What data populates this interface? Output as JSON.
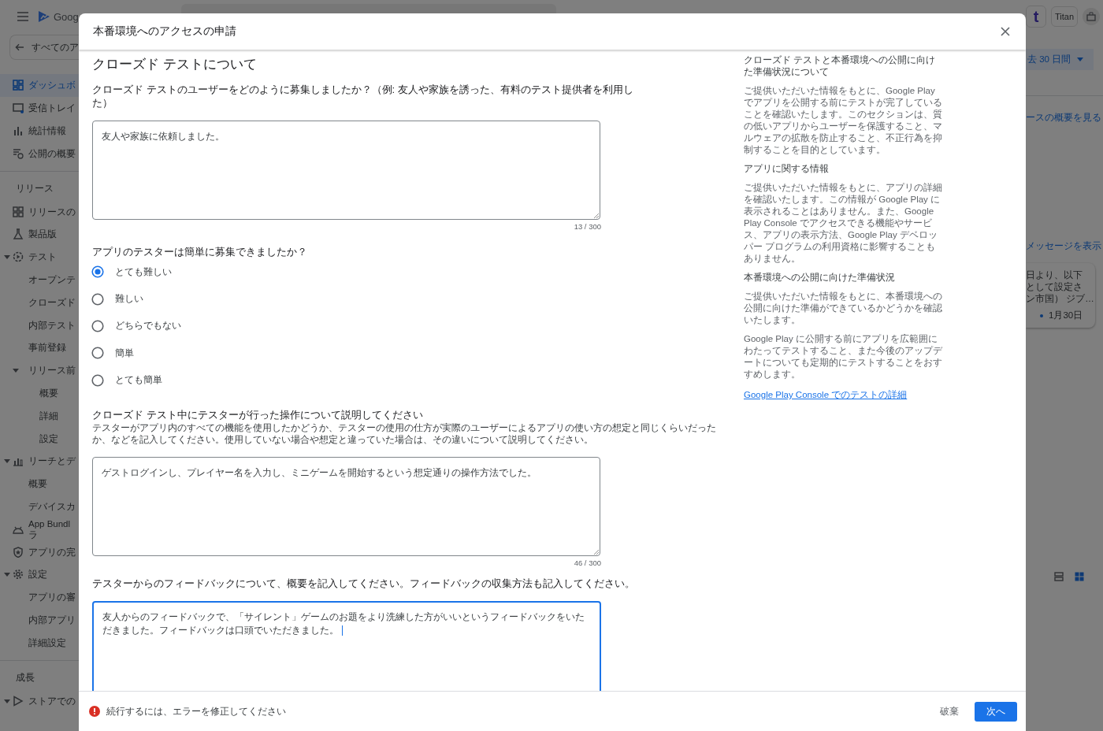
{
  "app_bar": {
    "logo_text": "Goog",
    "app_letter": "t",
    "account_name": "Titan"
  },
  "sidebar": {
    "back_link": "すべてのア",
    "sections": [
      {
        "items": [
          {
            "label": "ダッシュボ",
            "selected": true
          },
          {
            "label": "受信トレイ",
            "selected": false
          },
          {
            "label": "統計情報",
            "selected": false
          },
          {
            "label": "公開の概要",
            "selected": false
          }
        ]
      },
      {
        "heading": "リリース",
        "items": [
          {
            "label": "リリースの",
            "selected": false
          },
          {
            "label": "製品版",
            "selected": false
          },
          {
            "label": "テスト",
            "selected": false,
            "expanded": true,
            "children": [
              {
                "label": "オープンテ",
                "selected": false
              },
              {
                "label": "クローズド",
                "selected": false
              },
              {
                "label": "内部テスト",
                "selected": false
              },
              {
                "label": "事前登録",
                "selected": false
              },
              {
                "label": "リリース前",
                "selected": false,
                "expanded": true,
                "children": [
                  {
                    "label": "概要",
                    "selected": false
                  },
                  {
                    "label": "詳細",
                    "selected": false
                  },
                  {
                    "label": "設定",
                    "selected": false
                  }
                ]
              }
            ]
          },
          {
            "label": "リーチとデ",
            "selected": false,
            "expanded": true,
            "children": [
              {
                "label": "概要",
                "selected": false
              },
              {
                "label": "デバイスカ",
                "selected": false
              }
            ]
          },
          {
            "label": "App Bundl ラ",
            "selected": false
          },
          {
            "label": "アプリの完",
            "selected": false
          },
          {
            "label": "設定",
            "selected": false,
            "expanded": true,
            "children": [
              {
                "label": "アプリの審",
                "selected": false
              },
              {
                "label": "内部アプリ",
                "selected": false
              },
              {
                "label": "詳細設定",
                "selected": false
              }
            ]
          }
        ]
      },
      {
        "heading": "成長",
        "items": [
          {
            "label": "ストアでの",
            "selected": false,
            "expanded": true
          }
        ]
      }
    ]
  },
  "main_right": {
    "date_range": "去 30 日間",
    "overview_link": "ースの概要を見る",
    "messages_link": "メッセージを表示",
    "message_card": {
      "lines": [
        "日より、以下",
        "として設定さ",
        "ン市国） ジブ…"
      ],
      "date": "1月30日"
    },
    "view_toggle": [
      {
        "selected": false
      },
      {
        "selected": true
      }
    ]
  },
  "dialog": {
    "title": "本番環境へのアクセスの申請",
    "section_title": "クローズド テストについて",
    "questions": [
      {
        "kind": "textarea",
        "label": "クローズド テストのユーザーをどのように募集しましたか？（例: 友人や家族を誘った、有料のテスト提供者を利用した）",
        "value": "友人や家族に依頼しました。",
        "counter": "13 / 300",
        "focused": false
      },
      {
        "kind": "radio",
        "label": "アプリのテスターは簡単に募集できましたか？",
        "options": [
          {
            "label": "とても難しい",
            "selected": true
          },
          {
            "label": "難しい",
            "selected": false
          },
          {
            "label": "どちらでもない",
            "selected": false
          },
          {
            "label": "簡単",
            "selected": false
          },
          {
            "label": "とても簡単",
            "selected": false
          }
        ]
      },
      {
        "kind": "textarea",
        "label": "クローズド テスト中にテスターが行った操作について説明してください",
        "description": "テスターがアプリ内のすべての機能を使用したかどうか、テスターの使用の仕方が実際のユーザーによるアプリの使い方の想定と同じくらいだったか、などを記入してください。使用していない場合や想定と違っていた場合は、その違いについて説明してください。",
        "value": "ゲストログインし、プレイヤー名を入力し、ミニゲームを開始するという想定通りの操作方法でした。",
        "counter": "46 / 300",
        "focused": false
      },
      {
        "kind": "textarea",
        "label": "テスターからのフィードバックについて、概要を記入してください。フィードバックの収集方法も記入してください。",
        "value": "友人からのフィードバックで、「サイレント」ゲームのお題をより洗練した方がいいというフィードバックをいただきました。フィードバックは口頭でいただきました。",
        "focused": true
      }
    ],
    "help": [
      {
        "kind": "heading",
        "text": "クローズド テストと本番環境への公開に向けた準備状況について"
      },
      {
        "kind": "paragraph",
        "text": "ご提供いただいた情報をもとに、Google Play でアプリを公開する前にテストが完了していることを確認いたします。このセクションは、質の低いアプリからユーザーを保護すること、マルウェアの拡散を防止すること、不正行為を抑制することを目的としています。"
      },
      {
        "kind": "heading",
        "text": "アプリに関する情報"
      },
      {
        "kind": "paragraph",
        "text": "ご提供いただいた情報をもとに、アプリの詳細を確認いたします。この情報が Google Play に表示されることはありません。また、Google Play Console でアクセスできる機能やサービス、アプリの表示方法、Google Play デベロッパー プログラムの利用資格に影響することもありません。"
      },
      {
        "kind": "heading",
        "text": "本番環境への公開に向けた準備状況"
      },
      {
        "kind": "paragraph",
        "text": "ご提供いただいた情報をもとに、本番環境への公開に向けた準備ができているかどうかを確認いたします。"
      },
      {
        "kind": "paragraph",
        "text": "Google Play に公開する前にアプリを広範囲にわたってテストすること、また今後のアップデートについても定期的にテストすることをおすすめします。"
      },
      {
        "kind": "link",
        "text": "Google Play Console でのテストの詳細"
      }
    ],
    "footer": {
      "error": "続行するには、エラーを修正してください",
      "buttons": [
        {
          "kind": "text",
          "label": "破棄"
        },
        {
          "kind": "primary",
          "label": "次へ"
        }
      ]
    }
  }
}
